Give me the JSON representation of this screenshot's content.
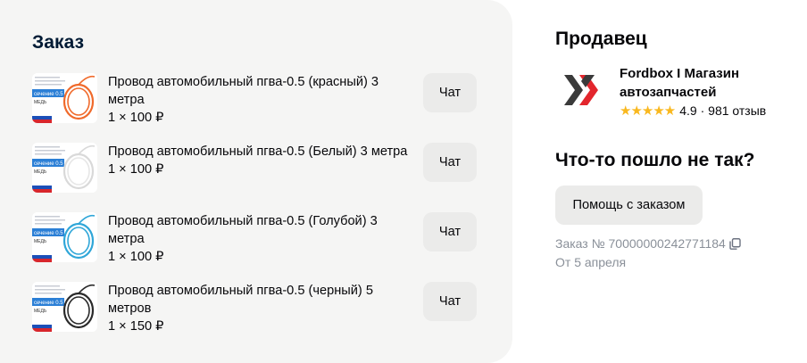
{
  "order": {
    "title": "Заказ",
    "items": [
      {
        "name": "Провод автомобильный пгва-0.5 (красный) 3 метра",
        "price": "1 × 100 ₽",
        "chat_label": "Чат",
        "wire_color": "#f06a2b"
      },
      {
        "name": "Провод автомобильный пгва-0.5 (Белый) 3 метра",
        "price": "1 × 100 ₽",
        "chat_label": "Чат",
        "wire_color": "#e6e6e6"
      },
      {
        "name": "Провод автомобильный пгва-0.5 (Голубой) 3 метра",
        "price": "1 × 100 ₽",
        "chat_label": "Чат",
        "wire_color": "#2fa6d8"
      },
      {
        "name": "Провод автомобильный пгва-0.5 (черный) 5 метров",
        "price": "1 × 150 ₽",
        "chat_label": "Чат",
        "wire_color": "#2a2a2a"
      }
    ],
    "thumb_label": "сечение 0.5 мм",
    "thumb_sublabel": "МЕДЬ"
  },
  "seller": {
    "title": "Продавец",
    "name": "Fordbox I Магазин автозапчастей",
    "stars": "★★★★★",
    "rating_text": "4.9 · 981 отзыв",
    "logo_colors": {
      "grey": "#3a3a3a",
      "red": "#e3262d"
    }
  },
  "problem": {
    "title": "Что-то пошло не так?",
    "help_label": "Помощь с заказом",
    "order_number": "Заказ № 70000000242771184",
    "order_date": "От 5 апреля"
  },
  "colors": {
    "accent_star": "#f9b81f",
    "muted_text": "#8a9099",
    "card_bg": "#f5f5f4"
  }
}
